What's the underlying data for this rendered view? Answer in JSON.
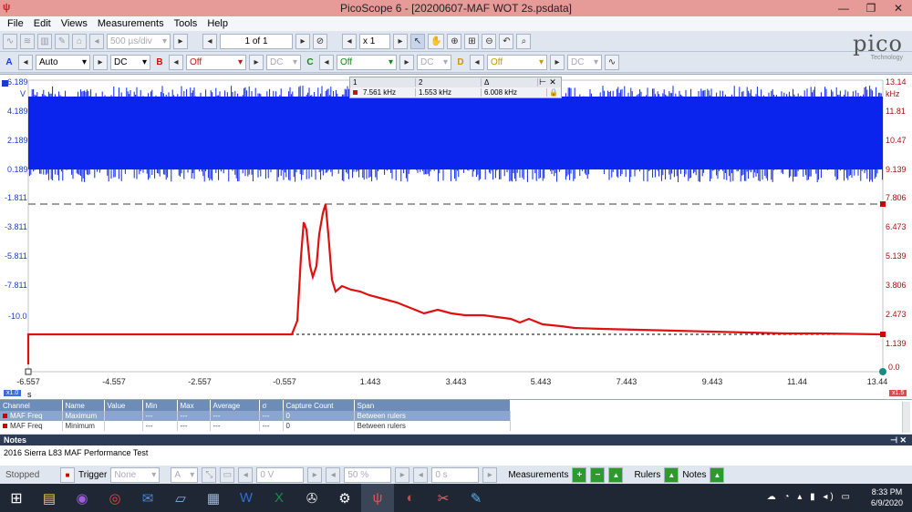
{
  "window": {
    "title": "PicoScope 6 - [20200607-MAF WOT 2s.psdata]",
    "min": "—",
    "restore": "❐",
    "close": "✕"
  },
  "menu": [
    "File",
    "Edit",
    "Views",
    "Measurements",
    "Tools",
    "Help"
  ],
  "toolbar1": {
    "timebase": "500 µs/div",
    "page": "1 of 1",
    "zoom": "x 1"
  },
  "channels": [
    {
      "label": "A",
      "range": "Auto",
      "coupling": "DC",
      "color": "#1a3ccc"
    },
    {
      "label": "B",
      "range": "Off",
      "coupling": "DC",
      "color": "#cc1111"
    },
    {
      "label": "C",
      "range": "Off",
      "coupling": "DC",
      "color": "#118811"
    },
    {
      "label": "D",
      "range": "Off",
      "coupling": "DC",
      "color": "#c49a00"
    }
  ],
  "logo": {
    "text": "pico",
    "sub": "Technology"
  },
  "plot": {
    "left_axis": {
      "unit": "V",
      "ticks": [
        "6.189",
        "4.189",
        "2.189",
        "0.189",
        "-1.811",
        "-3.811",
        "-5.811",
        "-7.811",
        "-10.0"
      ]
    },
    "right_axis": {
      "unit": "kHz",
      "ticks": [
        "13.14",
        "11.81",
        "10.47",
        "9.139",
        "7.806",
        "6.473",
        "5.139",
        "3.806",
        "2.473",
        "1.139",
        "0.0"
      ]
    },
    "x_axis": {
      "unit": "s",
      "ticks": [
        "-6.557",
        "-4.557",
        "-2.557",
        "-0.557",
        "1.443",
        "3.443",
        "5.443",
        "7.443",
        "9.443",
        "11.44",
        "13.44"
      ]
    },
    "left_zoom": "x1.0",
    "right_zoom": "x1.5"
  },
  "rulers": {
    "h1": "1",
    "h2": "2",
    "h3": "Δ",
    "v1": "7.561 kHz",
    "v2": "1.553 kHz",
    "v3": "6.008 kHz"
  },
  "measurements": {
    "headers": [
      "Channel",
      "Name",
      "Value",
      "Min",
      "Max",
      "Average",
      "σ",
      "Capture Count",
      "Span"
    ],
    "rows": [
      [
        "MAF Freq",
        "Maximum",
        "",
        "---",
        "---",
        "---",
        "---",
        "0",
        "Between rulers"
      ],
      [
        "MAF Freq",
        "Minimum",
        "",
        "---",
        "---",
        "---",
        "---",
        "0",
        "Between rulers"
      ]
    ]
  },
  "notes": {
    "title": "Notes",
    "text": "2016 Sierra L83 MAF Performance Test"
  },
  "status": {
    "stopped": "Stopped",
    "trigger": "Trigger",
    "trigger_mode": "None",
    "trig_ch": "A",
    "level": "0 V",
    "pct": "50 %",
    "delay": "0 s",
    "measurements": "Measurements",
    "rulers": "Rulers",
    "notes": "Notes"
  },
  "taskbar": {
    "time": "8:33 PM",
    "date": "6/9/2020"
  }
}
